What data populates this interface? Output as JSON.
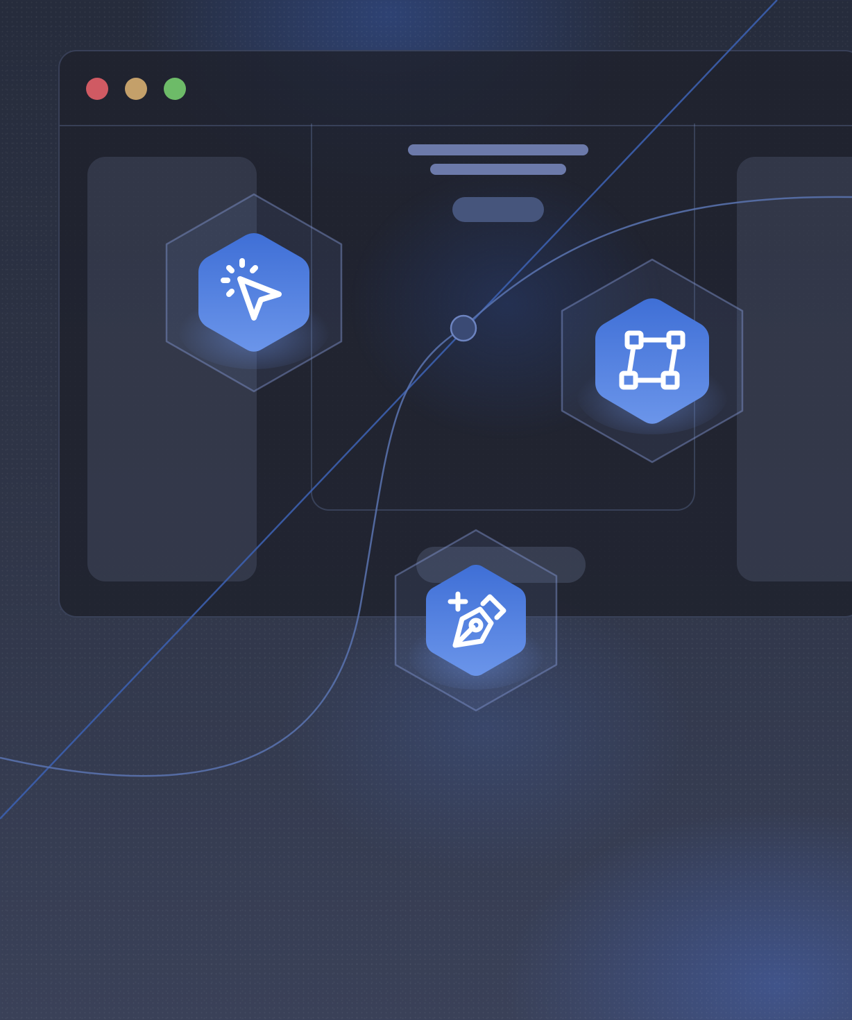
{
  "window": {
    "controls": [
      "close",
      "minimize",
      "maximize"
    ],
    "colors": {
      "close": "#d05a63",
      "minimize": "#c4a06a",
      "maximize": "#6dbb68"
    }
  },
  "tools": [
    {
      "icon": "pointer-click-icon"
    },
    {
      "icon": "transform-frame-icon"
    },
    {
      "icon": "pen-add-icon"
    }
  ],
  "accent_color": "#4f7ede"
}
